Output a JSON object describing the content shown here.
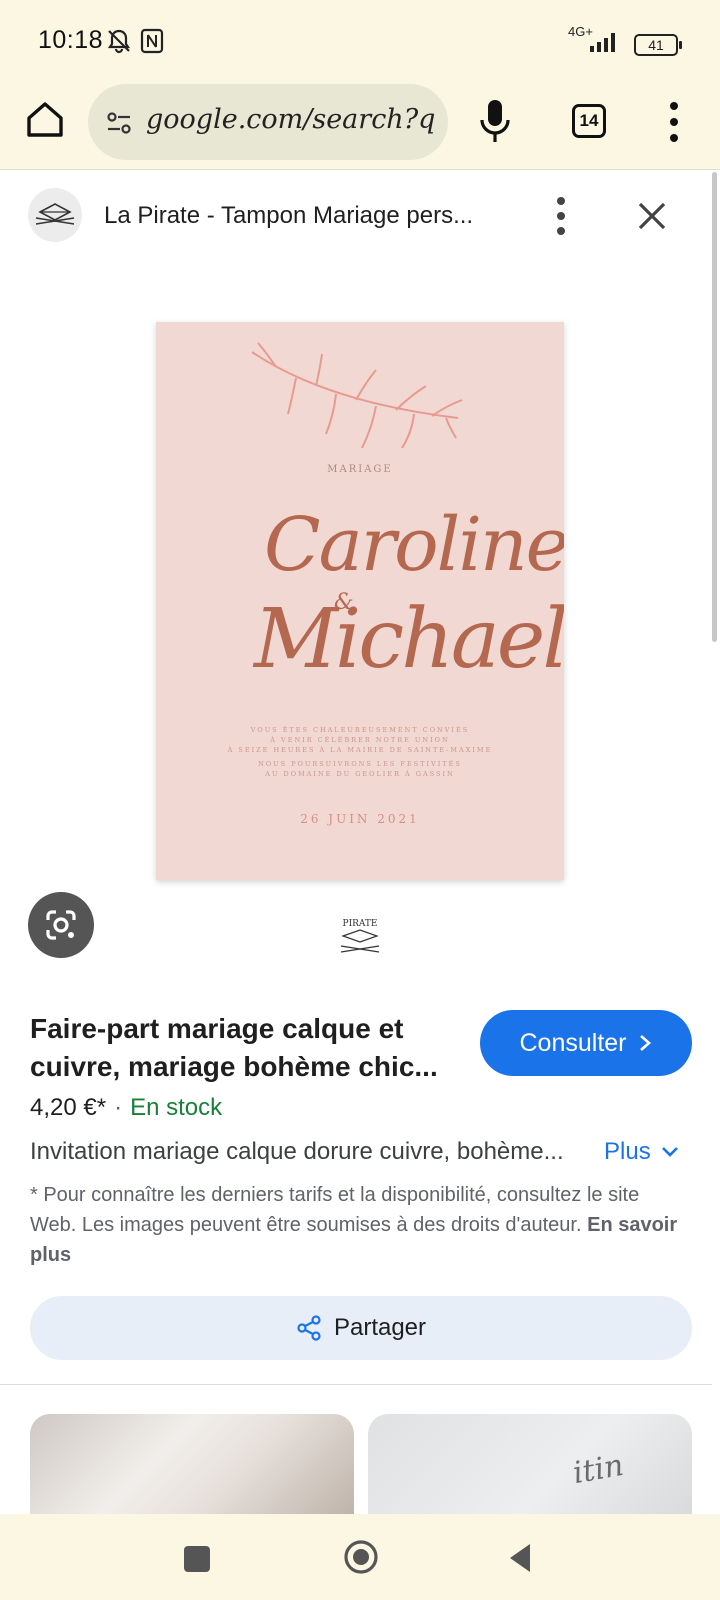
{
  "status_bar": {
    "time": "10:18",
    "network": "4G+",
    "battery": "41"
  },
  "browser": {
    "url": "google.com/search?q=",
    "tab_count": "14"
  },
  "panel": {
    "site_title": "La Pirate - Tampon Mariage pers...",
    "card": {
      "label": "MARIAGE",
      "name1": "Caroline",
      "amp": "&",
      "name2": "Michael",
      "text1_line1": "VOUS ÊTES CHALEUREUSEMENT CONVIÉS",
      "text1_line2": "À VENIR CÉLÉBRER NOTRE UNION",
      "text1_line3": "À SEIZE HEURES À LA MAIRIE DE SAINTE-MAXIME",
      "text2_line1": "NOUS POURSUIVRONS LES FESTIVITÉS",
      "text2_line2": "AU DOMAINE DU GEOLIER À GASSIN",
      "date": "26 JUIN 2021"
    },
    "brand_logo_text": "PIRATE",
    "product_title": "Faire-part mariage calque et cuivre, mariage bohème chic...",
    "visit_button": "Consulter",
    "price": "4,20 €*",
    "separator": "·",
    "stock": "En stock",
    "description": "Invitation mariage calque dorure cuivre, bohème...",
    "more_link": "Plus",
    "disclaimer": "* Pour connaître les derniers tarifs et la disponibilité, consultez le site Web. Les images peuvent être soumises à des droits d'auteur.",
    "learn_more": "En savoir plus",
    "share_button": "Partager",
    "related_script_text": "itin"
  },
  "colors": {
    "chrome_bg": "#fbf7e3",
    "accent_blue": "#1a73e8",
    "stock_green": "#188038",
    "card_pink": "#f2d8d2",
    "copper": "#b4684f"
  },
  "icons": {
    "home": "home-icon",
    "tune": "tune-icon",
    "mic": "mic-icon",
    "menu": "more-vert-icon",
    "close": "close-icon",
    "lens": "google-lens-icon",
    "share": "share-icon",
    "chevron": "chevron-right-icon",
    "expand": "chevron-down-icon"
  }
}
